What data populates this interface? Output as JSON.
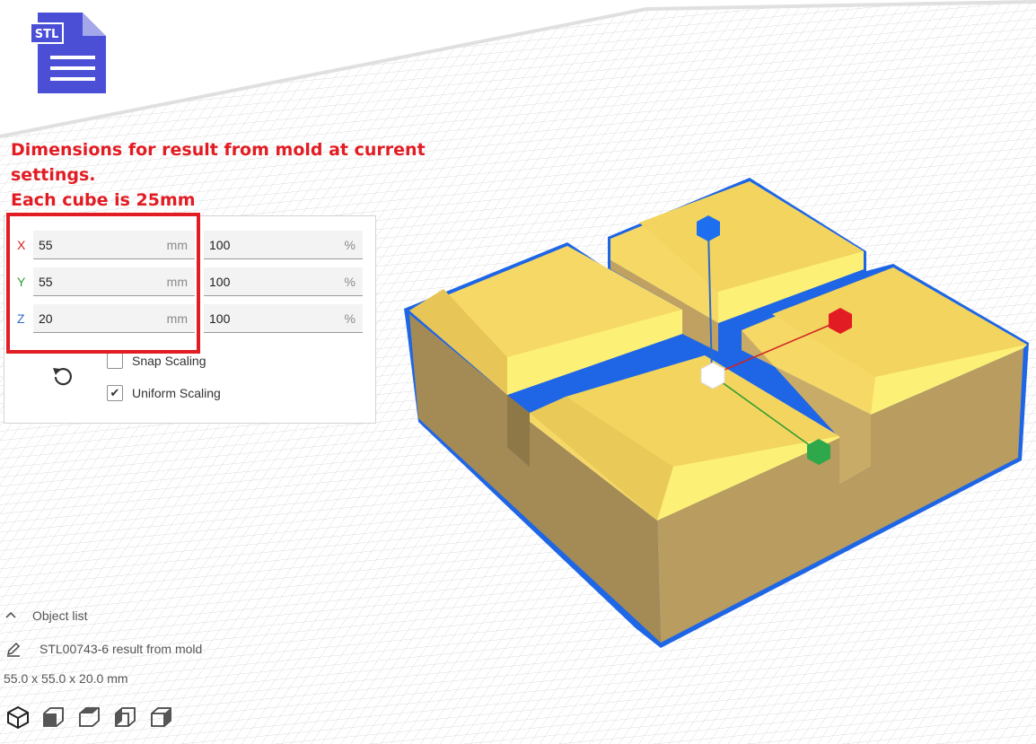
{
  "annotation": {
    "line1": "Dimensions for result from mold at current",
    "line2": "settings.",
    "line3": "Each cube is 25mm"
  },
  "stl_icon_label": "STL",
  "scale_panel": {
    "rows": [
      {
        "axis": "X",
        "color": "#d0231f",
        "mm_value": "55",
        "mm_unit": "mm",
        "pct_value": "100",
        "pct_unit": "%"
      },
      {
        "axis": "Y",
        "color": "#2e9b32",
        "mm_value": "55",
        "mm_unit": "mm",
        "pct_value": "100",
        "pct_unit": "%"
      },
      {
        "axis": "Z",
        "color": "#2d6cc8",
        "mm_value": "20",
        "mm_unit": "mm",
        "pct_value": "100",
        "pct_unit": "%"
      }
    ],
    "snap_scaling_label": "Snap Scaling",
    "snap_scaling_checked": false,
    "uniform_scaling_label": "Uniform Scaling",
    "uniform_scaling_checked": true,
    "reset_icon": "rotate-ccw-icon"
  },
  "object_list": {
    "header": "Object list",
    "object_name": "STL00743-6 result from mold",
    "dimensions": "55.0 x 55.0 x 20.0 mm"
  },
  "view_buttons": [
    "3d-view-icon",
    "front-view-icon",
    "top-view-icon",
    "left-view-icon",
    "right-view-icon"
  ],
  "colors": {
    "model_face": "#f6d866",
    "model_side": "#b2975c",
    "outline": "#1e66e6",
    "annotation": "#e21c23",
    "stl_icon": "#4a4fd6"
  }
}
